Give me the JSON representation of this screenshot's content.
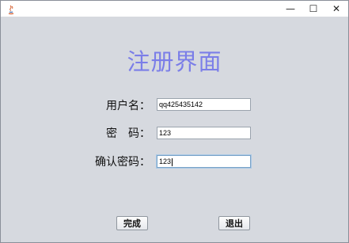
{
  "window": {
    "controls": {
      "minimize": "—",
      "maximize": "☐",
      "close": "✕"
    }
  },
  "form": {
    "heading": "注册界面",
    "fields": [
      {
        "label": "用户名：",
        "value": "qq425435142"
      },
      {
        "label": "密　码：",
        "value": "123"
      },
      {
        "label": "确认密码：",
        "value": "123"
      }
    ]
  },
  "buttons": {
    "submit": "完成",
    "exit": "退出"
  },
  "colors": {
    "heading": "#7b7ee8",
    "background": "#d6d9df"
  }
}
